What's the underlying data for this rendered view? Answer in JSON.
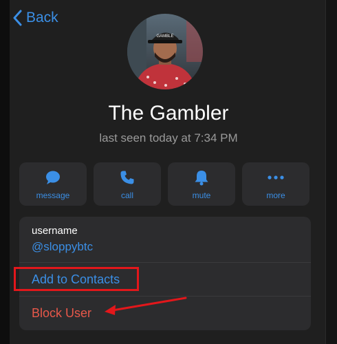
{
  "nav": {
    "back_label": "Back"
  },
  "profile": {
    "name": "The Gambler",
    "status": "last seen today at 7:34 PM",
    "avatar_cap_text": "GAMBLE"
  },
  "actions": [
    {
      "label": "message",
      "icon": "message-bubble-icon"
    },
    {
      "label": "call",
      "icon": "phone-icon"
    },
    {
      "label": "mute",
      "icon": "bell-icon"
    },
    {
      "label": "more",
      "icon": "ellipsis-icon"
    }
  ],
  "info": {
    "username_label": "username",
    "username_value": "@sloppybtc",
    "add_contact": "Add to Contacts",
    "block_user": "Block User"
  },
  "annotations": {
    "highlight_color": "#e3171b",
    "arrow_color": "#e3171b"
  },
  "colors": {
    "accent": "#3b8fe6",
    "destructive": "#e8584a",
    "background": "#1f1f1f",
    "card": "#2c2c2e"
  }
}
